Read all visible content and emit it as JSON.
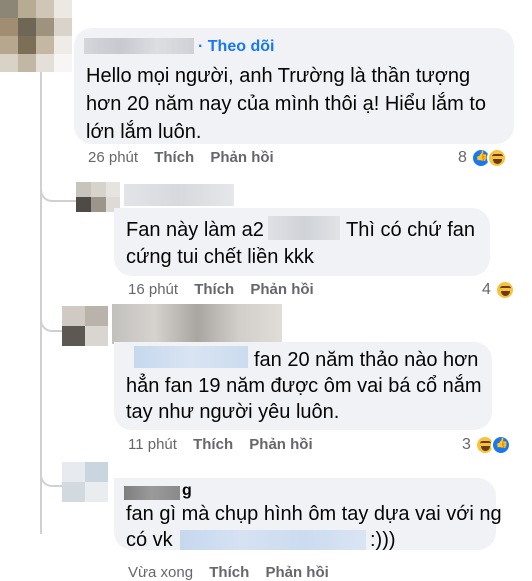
{
  "comments": [
    {
      "follow_label": "· Theo dõi",
      "text": "Hello mọi người, anh Trường là thần tượng hơn 20 năm nay của mình thôi ạ! Hiểu lắm to lớn lắm luôn.",
      "time": "26 phút",
      "like": "Thích",
      "reply": "Phản hồi",
      "reaction_count": "8",
      "reactions": [
        "like-icon",
        "haha-icon"
      ]
    },
    {
      "text_a": "Fan này làm a2",
      "text_b": "Thì có chứ fan",
      "text_c": "cứng tui chết liền kkk",
      "time": "16 phút",
      "like": "Thích",
      "reply": "Phản hồi",
      "reaction_count": "4",
      "reactions": [
        "haha-icon"
      ]
    },
    {
      "text_a": "fan 20 năm thảo nào hơn",
      "text_b": "hẳn fan 19 năm được ôm vai bá cổ nắm",
      "text_c": "tay như người yêu luôn.",
      "time": "11 phút",
      "like": "Thích",
      "reply": "Phản hồi",
      "reaction_count": "3",
      "reactions": [
        "haha-icon",
        "like-icon"
      ]
    },
    {
      "name_tail": "g",
      "text_a": "fan gì mà chụp hình ôm tay dựa vai với ng",
      "text_b_prefix": "có vk",
      "text_b_suffix": ":)))",
      "time": "Vừa xong",
      "like": "Thích",
      "reply": "Phản hồi"
    }
  ],
  "colors": {
    "bubble": "#f0f2f5",
    "meta": "#65676b",
    "link": "#1877f2",
    "thread": "#ced0d4"
  }
}
